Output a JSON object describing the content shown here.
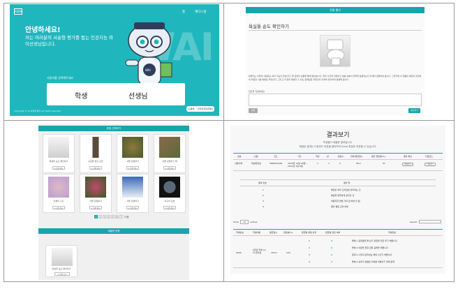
{
  "panel1": {
    "logo": "AISW",
    "nav": [
      "홈",
      "재디스플"
    ],
    "greeting": "안녕하세요!",
    "subtitle": "저는 여러분의 서술형 평가를 돕는 인공지능 와이선생님입니다.",
    "choose_prompt": "사용자를 선택해주세요",
    "roles": [
      "학생",
      "선생님"
    ],
    "background_text": "WAI",
    "robot_badge": "WAI",
    "footer": "Copyright © AI 서술형 평가 All rights reserved.",
    "badges": [
      "교육부",
      "한국과학창의재단"
    ],
    "colors": {
      "brand": "#1fb7bd"
    }
  },
  "panel2": {
    "header": "진행 평가",
    "title": "욕실을 순도 확인하기",
    "description": "양변기는 이렇게 사용되는 여러 기능이 있습니다. 물 관련한 상품을 통해 알아봅시다. 위의 사진을 관찰하고 생활 속에서 어떻게 활용되는지 자세히 설명하여 봅시다. 그렇다면 이 제품의 특징과 관련하여 적합한 사용 방법은 무엇인지, 그리고 이 경우 발생할 수 있는 문제점은 무엇인지 자세히 생각하여 설명해 봅시다.",
    "answer_label": "답안을 작성하세요",
    "prev_button": "이전",
    "next_button": "제출하기"
  },
  "panel3": {
    "header": "문항 선택하기",
    "cards": [
      {
        "caption": "욕실을 순도 확인하기",
        "button": "+ 답변 제시"
      },
      {
        "caption": "손잡을 벗긴 모습",
        "button": "+ 답변 제시"
      },
      {
        "caption": "식물 관찰하기",
        "button": "+ 답변 제시"
      },
      {
        "caption": "식물 관찰하기 팩",
        "button": "+ 답변 제시"
      },
      {
        "caption": "인체의 구조",
        "button": "+ 답변 제시"
      },
      {
        "caption": "식물 관찰하기",
        "button": "+ 답변 제시"
      },
      {
        "caption": "식물 관찰하기",
        "button": "+ 답변 제시"
      },
      {
        "caption": "지구의 모습",
        "button": "+ 답변 제시"
      }
    ],
    "pages": [
      "1",
      "2",
      "3",
      "4",
      "5",
      "6",
      "7"
    ],
    "pager_next": "다음",
    "saved_header": "제출한 문항",
    "saved_card": {
      "caption": "욕실을 순도 확인하기",
      "button": "+ 답변 보기"
    }
  },
  "panel4": {
    "title": "결과보기",
    "subtitle1": "학생들이 제출한 결과입니다.",
    "subtitle2": "채점된 결과는 다운로드 버튼을 클릭하여 Excel 파일로 저장할 수 있습니다.",
    "table1_headers": [
      "번호",
      "단원",
      "코드",
      "기간",
      "학년",
      "반",
      "응답수",
      "전체 평균점수",
      "평균 정답률(%)",
      "결과 확인",
      "다운로드"
    ],
    "table1_row": [
      "서론이해",
      "욕실화장실",
      "SENSHOGIN",
      "2020년 12월 28일 ~ 2021년 1월 8일",
      "1",
      "1",
      "4",
      "96.2",
      "91",
      "결과보기",
      "다운로드"
    ],
    "table2_headers": [
      "결과 번호",
      "결과 명"
    ],
    "table2_rows": [
      [
        "1",
        "배관은 여러 교차로를 유지하는 것"
      ],
      [
        "2",
        "배관을 깨끗하게 관리할 것"
      ],
      [
        "3",
        "바람직한 방법 거의 일 하면 안 됨"
      ],
      [
        "4",
        "결과 결핍 교차 여부"
      ]
    ],
    "show_label": "Show",
    "show_value": "10",
    "entries_label": "entries",
    "search_label": "Search:",
    "table3_headers": [
      "학생번호",
      "학생이름",
      "평균점수",
      "정답률(%)",
      "문항별 채점 유무",
      "문항별 정답 여부",
      "학생답변"
    ],
    "table3_row": {
      "student_no": "9999",
      "name": "9학년 학생 12학 전학생",
      "avg": "100.0",
      "rate": "100"
    },
    "answers": [
      {
        "q": "1",
        "mark": "O",
        "text": "물체 1 관찰결과 물 상기 유입을 위한 무기 해줍니다"
      },
      {
        "q": "2",
        "mark": "O",
        "text": "물체 2 이론을 위한 관찰 공명을 해줍니다"
      },
      {
        "q": "3",
        "mark": "O",
        "text": "문제 3 나무의 관리하는 배의 누군가 해줍니다"
      },
      {
        "q": "4",
        "mark": "O",
        "text": "물체 4 상처가 벗용된 이해를 바탕하기 위해 문제"
      }
    ]
  }
}
